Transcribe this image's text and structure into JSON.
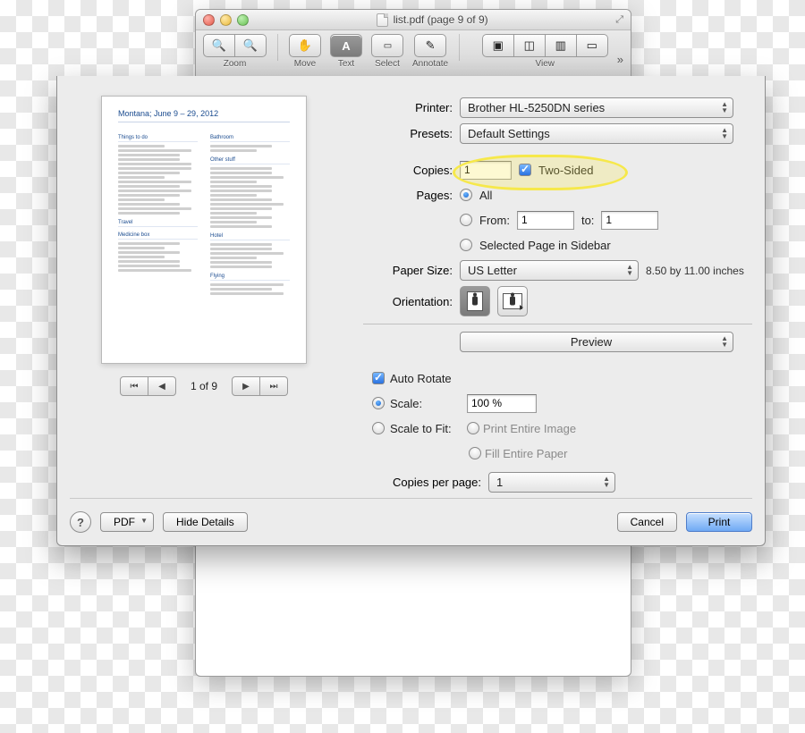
{
  "window": {
    "title": "list.pdf (page 9 of 9)"
  },
  "toolbar": {
    "zoom_label": "Zoom",
    "move_label": "Move",
    "text_label": "Text",
    "select_label": "Select",
    "annotate_label": "Annotate",
    "view_label": "View"
  },
  "preview_thumb": {
    "doc_title": "Montana; June 9 – 29, 2012",
    "headings": {
      "things": "Things to do",
      "bathroom": "Bathroom",
      "other": "Other stuff",
      "travel": "Travel",
      "medicine": "Medicine box",
      "hotel": "Hotel",
      "flying": "Flying"
    }
  },
  "preview_nav": {
    "caption": "1 of 9"
  },
  "form": {
    "printer_label": "Printer:",
    "printer_value": "Brother HL-5250DN series",
    "presets_label": "Presets:",
    "presets_value": "Default Settings",
    "copies_label": "Copies:",
    "copies_value": "1",
    "two_sided_label": "Two-Sided",
    "pages_label": "Pages:",
    "all_label": "All",
    "from_label": "From:",
    "from_value": "1",
    "to_label": "to:",
    "to_value": "1",
    "selected_label": "Selected Page in Sidebar",
    "paper_size_label": "Paper Size:",
    "paper_size_value": "US Letter",
    "paper_size_dims": "8.50 by 11.00 inches",
    "orientation_label": "Orientation:",
    "section_popup": "Preview",
    "auto_rotate_label": "Auto Rotate",
    "scale_label": "Scale:",
    "scale_value": "100 %",
    "scale_fit_label": "Scale to Fit:",
    "print_entire_label": "Print Entire Image",
    "fill_paper_label": "Fill Entire Paper",
    "copies_per_page_label": "Copies per page:",
    "copies_per_page_value": "1"
  },
  "footer": {
    "pdf_label": "PDF",
    "hide_details_label": "Hide Details",
    "cancel_label": "Cancel",
    "print_label": "Print"
  }
}
